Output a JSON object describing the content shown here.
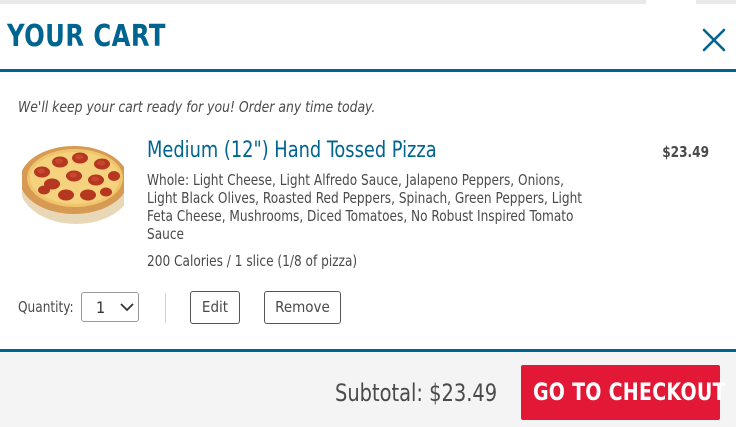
{
  "header": {
    "title": "YOUR CART"
  },
  "cart": {
    "note": "We'll keep your cart ready for you! Order any time today.",
    "item": {
      "name": "Medium (12\") Hand Tossed Pizza",
      "price": "$23.49",
      "toppings": "Whole: Light Cheese, Light Alfredo Sauce, Jalapeno Peppers, Onions, Light Black Olives, Roasted Red Peppers, Spinach, Green Peppers, Light Feta Cheese, Mushrooms, Diced Tomatoes, No Robust Inspired Tomato Sauce",
      "calories": "200 Calories / 1 slice (1/8 of pizza)",
      "image_icon": "pepperoni-pizza-image"
    },
    "quantity": {
      "label": "Quantity:",
      "value": "1"
    },
    "actions": {
      "edit_label": "Edit",
      "remove_label": "Remove"
    }
  },
  "footer": {
    "subtotal_label": "Subtotal: $23.49",
    "checkout_label": "GO TO CHECKOUT"
  },
  "colors": {
    "brand_blue": "#006491",
    "brand_red": "#e31837",
    "text": "#4a4a4a",
    "footer_bg": "#f4f4f4"
  },
  "icons": {
    "close": "close-icon",
    "quantity_dropdown": "chevron-down-icon"
  }
}
